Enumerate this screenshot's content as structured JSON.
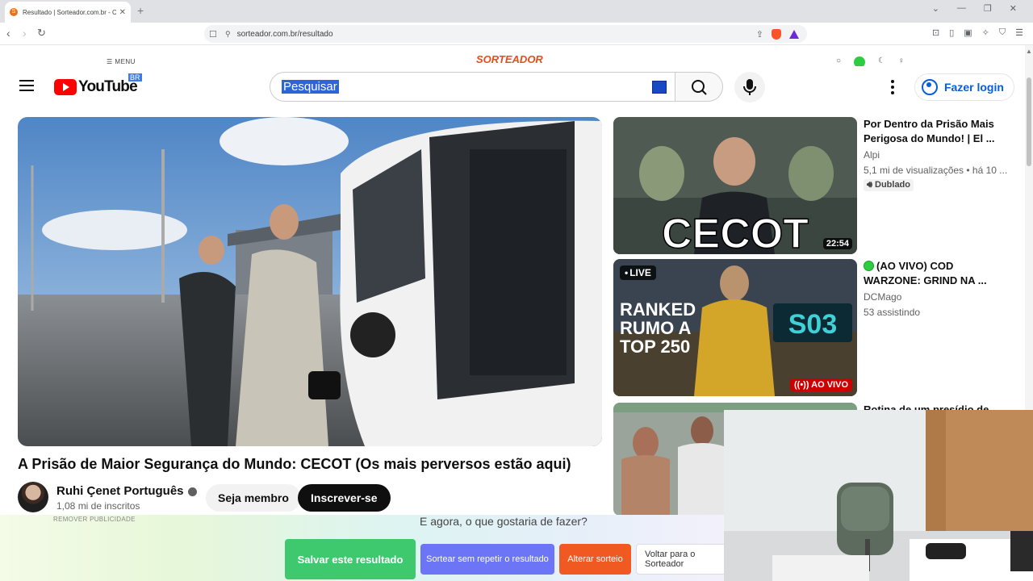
{
  "browser": {
    "tab_title": "Resultado | Sorteador.com.br - C",
    "tab_close": "✕",
    "new_tab": "+",
    "url": "sorteador.com.br/resultado"
  },
  "sorteador": {
    "menu_label": "MENU",
    "logo_text": "SORTEADOR",
    "remove_ads": "REMOVER PUBLICIDADE",
    "question": "E agora, o que gostaria de fazer?",
    "buttons": {
      "save": "Salvar este resultado",
      "no_repeat": "Sortear sem repetir o resultado",
      "change": "Alterar sorteio",
      "back": "Voltar para o Sorteador"
    }
  },
  "youtube": {
    "logo_word": "YouTube",
    "country": "BR",
    "search_placeholder": "Pesquisar",
    "login_label": "Fazer login",
    "main_video": {
      "title": "A Prisão de Maior Segurança do Mundo: CECOT (Os mais perversos estão aqui)",
      "channel": "Ruhi Çenet Português",
      "subscribers": "1,08 mi de inscritos",
      "member_button": "Seja membro",
      "subscribe_button": "Inscrever-se"
    },
    "recommendations": [
      {
        "title": "Por Dentro da Prisão Mais Perigosa do Mundo! | El ...",
        "channel": "Alpi",
        "meta": "5,1 mi de visualizações • há 10 ...",
        "badge": "Dublado",
        "duration": "22:54",
        "thumb_text": "CECOT"
      },
      {
        "title": "(AO VIVO) COD WARZONE: GRIND NA ...",
        "channel": "DCMago",
        "meta": "53 assistindo",
        "live_label": "LIVE",
        "live_badge": "AO VIVO",
        "thumb_text_1": "RANKED",
        "thumb_text_2": "RUMO A",
        "thumb_text_3": "TOP 250",
        "thumb_text_4": "S03"
      },
      {
        "title": "Rotina de um presídio de"
      }
    ]
  },
  "colors": {
    "yt_red": "#ff0000",
    "yt_link": "#065fd4",
    "save_green": "#3ec96e",
    "norep_blue": "#6b75f5",
    "alter_orange": "#f05a22"
  }
}
